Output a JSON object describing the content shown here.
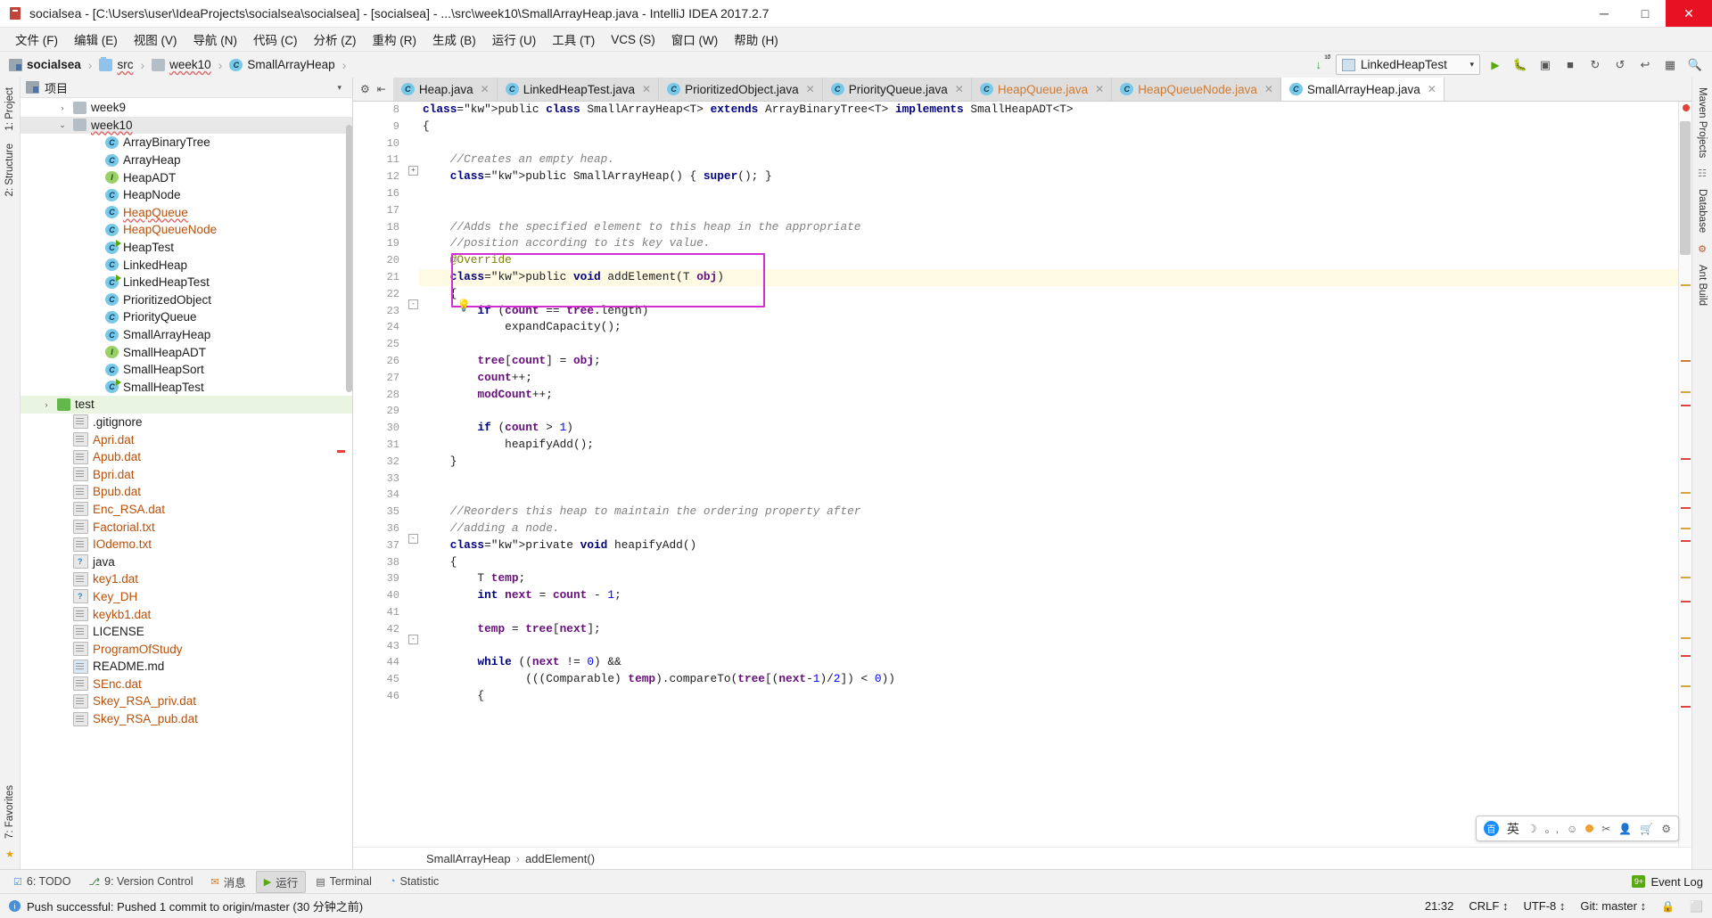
{
  "window": {
    "title": "socialsea - [C:\\Users\\user\\IdeaProjects\\socialsea\\socialsea] - [socialsea] - ...\\src\\week10\\SmallArrayHeap.java - IntelliJ IDEA 2017.2.7",
    "minimize": "─",
    "maximize": "□",
    "close": "✕"
  },
  "menubar": {
    "items": [
      "文件 (F)",
      "编辑 (E)",
      "视图 (V)",
      "导航 (N)",
      "代码 (C)",
      "分析 (Z)",
      "重构 (R)",
      "生成 (B)",
      "运行 (U)",
      "工具 (T)",
      "VCS (S)",
      "窗口 (W)",
      "帮助 (H)"
    ]
  },
  "breadcrumb": {
    "items": [
      {
        "label": "socialsea",
        "icon": "project-icon",
        "style": "bold"
      },
      {
        "label": "src",
        "icon": "source-folder-icon",
        "style": "spell"
      },
      {
        "label": "week10",
        "icon": "folder-icon",
        "style": "spell"
      },
      {
        "label": "SmallArrayHeap",
        "icon": "class-icon",
        "style": "plain"
      }
    ],
    "separator": "›"
  },
  "run_toolbar": {
    "update_label": "10 01",
    "config_name": "LinkedHeapTest",
    "chevron": "⌵",
    "run": "▶",
    "debug": "🐞",
    "coverage": "▣",
    "stop": "■",
    "attach": "↻",
    "sync": "↺",
    "undo": "↩",
    "layout": "▦",
    "search": "🔍"
  },
  "project_panel": {
    "title": "项目",
    "collapse_chevron": "▾",
    "tree": [
      {
        "label": "week9",
        "icon": "folder-icon",
        "indent": 2,
        "arrow": "›",
        "state": "normal"
      },
      {
        "label": "week10",
        "icon": "folder-icon",
        "indent": 2,
        "arrow": "⌄",
        "state": "selected",
        "spell": true
      },
      {
        "label": "ArrayBinaryTree",
        "icon": "class-icon",
        "indent": 4,
        "arrow": "",
        "state": "normal"
      },
      {
        "label": "ArrayHeap",
        "icon": "class-icon",
        "indent": 4,
        "arrow": "",
        "state": "normal"
      },
      {
        "label": "HeapADT",
        "icon": "interface-icon",
        "indent": 4,
        "arrow": "",
        "state": "normal"
      },
      {
        "label": "HeapNode",
        "icon": "class-icon",
        "indent": 4,
        "arrow": "",
        "state": "normal"
      },
      {
        "label": "HeapQueue",
        "icon": "class-icon",
        "indent": 4,
        "arrow": "",
        "state": "modified",
        "spell": true
      },
      {
        "label": "HeapQueueNode",
        "icon": "class-icon",
        "indent": 4,
        "arrow": "",
        "state": "modified"
      },
      {
        "label": "HeapTest",
        "icon": "runnable-class-icon",
        "indent": 4,
        "arrow": "",
        "state": "normal"
      },
      {
        "label": "LinkedHeap",
        "icon": "class-icon",
        "indent": 4,
        "arrow": "",
        "state": "normal"
      },
      {
        "label": "LinkedHeapTest",
        "icon": "runnable-class-icon",
        "indent": 4,
        "arrow": "",
        "state": "normal"
      },
      {
        "label": "PrioritizedObject",
        "icon": "class-icon",
        "indent": 4,
        "arrow": "",
        "state": "normal"
      },
      {
        "label": "PriorityQueue",
        "icon": "class-icon",
        "indent": 4,
        "arrow": "",
        "state": "normal"
      },
      {
        "label": "SmallArrayHeap",
        "icon": "class-icon",
        "indent": 4,
        "arrow": "",
        "state": "normal"
      },
      {
        "label": "SmallHeapADT",
        "icon": "interface-icon",
        "indent": 4,
        "arrow": "",
        "state": "normal"
      },
      {
        "label": "SmallHeapSort",
        "icon": "class-icon",
        "indent": 4,
        "arrow": "",
        "state": "normal"
      },
      {
        "label": "SmallHeapTest",
        "icon": "runnable-class-icon",
        "indent": 4,
        "arrow": "",
        "state": "normal"
      },
      {
        "label": "test",
        "icon": "test-folder-icon",
        "indent": 1,
        "arrow": "›",
        "state": "green"
      },
      {
        "label": ".gitignore",
        "icon": "file-icon",
        "indent": 2,
        "arrow": "",
        "state": "normal"
      },
      {
        "label": "Apri.dat",
        "icon": "file-icon",
        "indent": 2,
        "arrow": "",
        "state": "modified"
      },
      {
        "label": "Apub.dat",
        "icon": "file-icon",
        "indent": 2,
        "arrow": "",
        "state": "modified"
      },
      {
        "label": "Bpri.dat",
        "icon": "file-icon",
        "indent": 2,
        "arrow": "",
        "state": "modified"
      },
      {
        "label": "Bpub.dat",
        "icon": "file-icon",
        "indent": 2,
        "arrow": "",
        "state": "modified"
      },
      {
        "label": "Enc_RSA.dat",
        "icon": "file-icon",
        "indent": 2,
        "arrow": "",
        "state": "modified"
      },
      {
        "label": "Factorial.txt",
        "icon": "file-icon",
        "indent": 2,
        "arrow": "",
        "state": "modified"
      },
      {
        "label": "IOdemo.txt",
        "icon": "file-icon",
        "indent": 2,
        "arrow": "",
        "state": "modified"
      },
      {
        "label": "java",
        "icon": "unknown-file-icon",
        "indent": 2,
        "arrow": "",
        "state": "normal"
      },
      {
        "label": "key1.dat",
        "icon": "file-icon",
        "indent": 2,
        "arrow": "",
        "state": "modified"
      },
      {
        "label": "Key_DH",
        "icon": "unknown-file-icon",
        "indent": 2,
        "arrow": "",
        "state": "modified"
      },
      {
        "label": "keykb1.dat",
        "icon": "file-icon",
        "indent": 2,
        "arrow": "",
        "state": "modified"
      },
      {
        "label": "LICENSE",
        "icon": "file-icon",
        "indent": 2,
        "arrow": "",
        "state": "normal"
      },
      {
        "label": "ProgramOfStudy",
        "icon": "file-icon",
        "indent": 2,
        "arrow": "",
        "state": "modified"
      },
      {
        "label": "README.md",
        "icon": "markdown-file-icon",
        "indent": 2,
        "arrow": "",
        "state": "normal"
      },
      {
        "label": "SEnc.dat",
        "icon": "file-icon",
        "indent": 2,
        "arrow": "",
        "state": "modified"
      },
      {
        "label": "Skey_RSA_priv.dat",
        "icon": "file-icon",
        "indent": 2,
        "arrow": "",
        "state": "modified"
      },
      {
        "label": "Skey_RSA_pub.dat",
        "icon": "file-icon",
        "indent": 2,
        "arrow": "",
        "state": "modified"
      }
    ]
  },
  "left_rail": {
    "items": [
      "1: Project",
      "2: Structure",
      "7: Favorites"
    ]
  },
  "right_rail": {
    "items": [
      "Maven Projects",
      "Database",
      "Ant Build"
    ]
  },
  "editor_tabs": {
    "gear": "⚙",
    "collapse": "⇤",
    "tabs": [
      {
        "label": "Heap.java",
        "icon": "class-icon",
        "active": false,
        "modified": false,
        "close": "✕"
      },
      {
        "label": "LinkedHeapTest.java",
        "icon": "class-icon",
        "active": false,
        "modified": false,
        "close": "✕"
      },
      {
        "label": "PrioritizedObject.java",
        "icon": "class-icon",
        "active": false,
        "modified": false,
        "close": "✕"
      },
      {
        "label": "PriorityQueue.java",
        "icon": "class-icon",
        "active": false,
        "modified": false,
        "close": "✕"
      },
      {
        "label": "HeapQueue.java",
        "icon": "class-icon",
        "active": false,
        "modified": true,
        "close": "✕"
      },
      {
        "label": "HeapQueueNode.java",
        "icon": "class-icon",
        "active": false,
        "modified": true,
        "close": "✕"
      },
      {
        "label": "SmallArrayHeap.java",
        "icon": "class-icon",
        "active": true,
        "modified": false,
        "close": "✕"
      }
    ]
  },
  "editor": {
    "first_line_number": 8,
    "lines": [
      {
        "n": 8,
        "text": "public class SmallArrayHeap<T> extends ArrayBinaryTree<T> implements SmallHeapADT<T>",
        "partial": true
      },
      {
        "n": 9,
        "text": "{"
      },
      {
        "n": 10,
        "text": ""
      },
      {
        "n": 11,
        "text": "    //Creates an empty heap."
      },
      {
        "n": 12,
        "text": "    public SmallArrayHeap() { super(); }"
      },
      {
        "n": 16,
        "text": ""
      },
      {
        "n": 17,
        "text": ""
      },
      {
        "n": 18,
        "text": "    //Adds the specified element to this heap in the appropriate"
      },
      {
        "n": 19,
        "text": "    //position according to its key value."
      },
      {
        "n": 20,
        "text": "    @Override"
      },
      {
        "n": 21,
        "text": "    public void addElement(T obj)"
      },
      {
        "n": 22,
        "text": "    {"
      },
      {
        "n": 23,
        "text": "        if (count == tree.length)"
      },
      {
        "n": 24,
        "text": "            expandCapacity();"
      },
      {
        "n": 25,
        "text": ""
      },
      {
        "n": 26,
        "text": "        tree[count] = obj;"
      },
      {
        "n": 27,
        "text": "        count++;"
      },
      {
        "n": 28,
        "text": "        modCount++;"
      },
      {
        "n": 29,
        "text": ""
      },
      {
        "n": 30,
        "text": "        if (count > 1)"
      },
      {
        "n": 31,
        "text": "            heapifyAdd();"
      },
      {
        "n": 32,
        "text": "    }"
      },
      {
        "n": 33,
        "text": ""
      },
      {
        "n": 34,
        "text": ""
      },
      {
        "n": 35,
        "text": "    //Reorders this heap to maintain the ordering property after"
      },
      {
        "n": 36,
        "text": "    //adding a node."
      },
      {
        "n": 37,
        "text": "    private void heapifyAdd()"
      },
      {
        "n": 38,
        "text": "    {"
      },
      {
        "n": 39,
        "text": "        T temp;"
      },
      {
        "n": 40,
        "text": "        int next = count - 1;"
      },
      {
        "n": 41,
        "text": ""
      },
      {
        "n": 42,
        "text": "        temp = tree[next];"
      },
      {
        "n": 43,
        "text": ""
      },
      {
        "n": 44,
        "text": "        while ((next != 0) &&"
      },
      {
        "n": 45,
        "text": "               (((Comparable) temp).compareTo(tree[(next-1)/2]) < 0))"
      },
      {
        "n": 46,
        "text": "        {"
      }
    ],
    "bulb_icon": "💡",
    "highlight_box": "addElement-method-highlight",
    "caret_line": 21,
    "error_dot": "error-indicator"
  },
  "editor_breadcrumb": {
    "class": "SmallArrayHeap",
    "method": "addElement()",
    "separator": "›"
  },
  "ime_widget": {
    "logo": "百",
    "mode": "英",
    "moon": "☽",
    "punct": "。,",
    "smiley": "☺",
    "scissors": "✂",
    "person": "👤",
    "cart": "🛒",
    "gear": "⚙"
  },
  "bottom_bar": {
    "items": [
      {
        "label": "6: TODO",
        "icon": "todo-icon",
        "active": false
      },
      {
        "label": "9: Version Control",
        "icon": "vcs-icon",
        "active": false
      },
      {
        "label": "消息",
        "icon": "message-icon",
        "active": false
      },
      {
        "label": "运行",
        "icon": "run-icon",
        "active": true
      },
      {
        "label": "Terminal",
        "icon": "terminal-icon",
        "active": false
      },
      {
        "label": "Statistic",
        "icon": "statistic-icon",
        "active": false
      }
    ],
    "event_log": "Event Log",
    "event_badge": "9+"
  },
  "status_bar": {
    "message": "Push successful: Pushed 1 commit to origin/master (30 分钟之前)",
    "time": "21:32",
    "line_separator": "CRLF ↕",
    "encoding": "UTF-8 ↕",
    "branch": "Git: master ↕",
    "lock_icon": "🔒",
    "hide_icon": "⬜"
  },
  "colors": {
    "accent_green": "#59a910",
    "modified_orange": "#b8500a",
    "highlight_magenta": "#d12fd1",
    "caret_line": "#fffae3",
    "close_red": "#e81123",
    "keyword_blue": "#000080",
    "comment_gray": "#808080",
    "field_purple": "#660e7a",
    "number_blue": "#0000ff",
    "annotation_olive": "#808000"
  }
}
